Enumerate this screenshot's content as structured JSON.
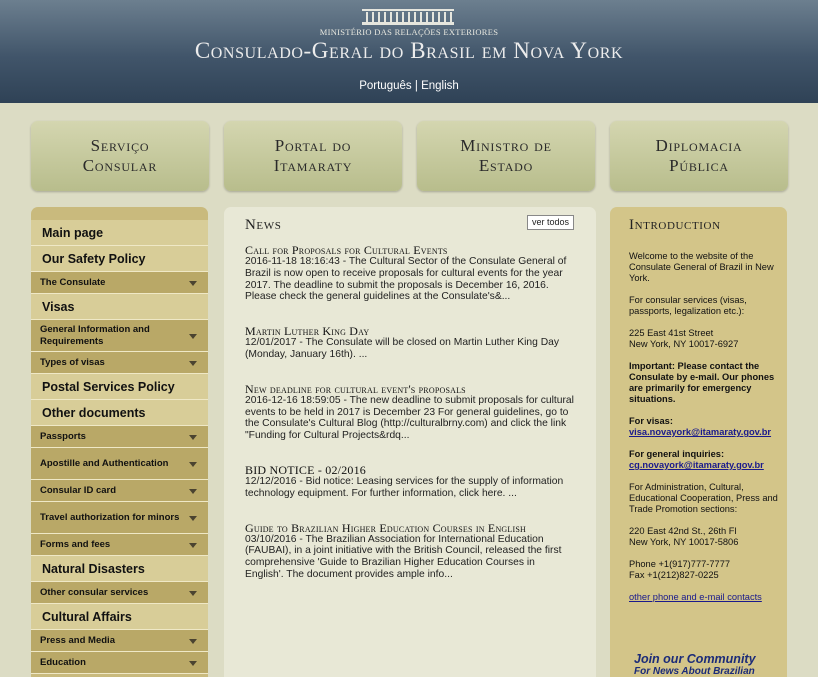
{
  "header": {
    "ministry": "MINISTÉRIO DAS RELAÇÕES EXTERIORES",
    "title": "Consulado-Geral do Brasil em Nova York",
    "lang_pt": "Português",
    "lang_sep": "|",
    "lang_en": "English"
  },
  "topnav": [
    {
      "line1": "Serviço",
      "line2": "Consular"
    },
    {
      "line1": "Portal do",
      "line2": "Itamaraty"
    },
    {
      "line1": "Ministro de",
      "line2": "Estado"
    },
    {
      "line1": "Diplomacia",
      "line2": "Pública"
    }
  ],
  "sidebar": {
    "items": [
      {
        "label": "Main page",
        "type": "big"
      },
      {
        "label": "Our Safety Policy",
        "type": "big"
      },
      {
        "label": "The Consulate",
        "type": "small"
      },
      {
        "label": "Visas",
        "type": "big"
      },
      {
        "label": "General Information and Requirements",
        "type": "small"
      },
      {
        "label": "Types of visas",
        "type": "small"
      },
      {
        "label": "Postal Services Policy",
        "type": "big"
      },
      {
        "label": "Other documents",
        "type": "big"
      },
      {
        "label": "Passports",
        "type": "small"
      },
      {
        "label": "Apostille and Authentication",
        "type": "small"
      },
      {
        "label": "Consular ID card",
        "type": "small"
      },
      {
        "label": "Travel authorization for minors",
        "type": "small"
      },
      {
        "label": "Forms and fees",
        "type": "small"
      },
      {
        "label": "Natural Disasters",
        "type": "big"
      },
      {
        "label": "Other consular services",
        "type": "small"
      },
      {
        "label": "Cultural Affairs",
        "type": "big"
      },
      {
        "label": "Press and Media",
        "type": "small"
      },
      {
        "label": "Education",
        "type": "small"
      }
    ]
  },
  "news": {
    "heading": "News",
    "see_all": "ver todos",
    "items": [
      {
        "title": "Call for Proposals for Cultural Events",
        "body": "2016-11-18 18:16:43 - The Cultural Sector of the Consulate General of Brazil is now open to receive proposals for cultural events for the year 2017. The deadline to submit the proposals is December 16, 2016. Please check the general guidelines at the Consulate's&..."
      },
      {
        "title": "Martin Luther King Day",
        "body": "12/01/2017 - The Consulate will be closed on Martin Luther King Day (Monday, January 16th). ..."
      },
      {
        "title": "New deadline for cultural event's proposals",
        "body": "2016-12-16 18:59:05 - The new deadline to submit proposals for cultural events to be held in 2017 is December 23 For general guidelines, go to the Consulate's Cultural Blog (http://culturalbrny.com) and click the link \"Funding for Cultural Projects&rdq..."
      },
      {
        "title": "BID NOTICE - 02/2016",
        "body": "12/12/2016 - Bid notice: Leasing services for the supply of information technology equipment. For further information, click here.  ..."
      },
      {
        "title": "Guide to Brazilian Higher Education Courses in English",
        "body": "03/10/2016 - The Brazilian Association for International Education (FAUBAI), in a joint initiative with the British Council, released the first comprehensive 'Guide to Brazilian Higher Education Courses in English'. The document provides ample info..."
      }
    ]
  },
  "intro": {
    "heading": "Introduction",
    "welcome": "Welcome to the website of the Consulate General of Brazil in New York.",
    "consular_services": "For consular services (visas, passports, legalization etc.):",
    "address1_line1": "225 East 41st Street",
    "address1_line2": "New York, NY 10017-6927",
    "important": "Important: Please contact the Consulate by e-mail. Our phones are primarily for emergency situations.",
    "visas_label": "For visas:",
    "visas_email": "visa.novayork@itamaraty.gov.br",
    "general_label": "For general inquiries:",
    "general_email": "cg.novayork@itamaraty.gov.br",
    "admin_text": "For Administration, Cultural, Educational Cooperation, Press and Trade Promotion sections:",
    "address2_line1": "220 East 42nd St., 26th Fl",
    "address2_line2": "New York, NY 10017-5806",
    "phone": "Phone +1(917)777-7777",
    "fax": "Fax +1(212)827-0225",
    "other_contacts": "other phone and e-mail contacts",
    "join": "Join our Community",
    "join_sub": "For News About Brazilian"
  }
}
